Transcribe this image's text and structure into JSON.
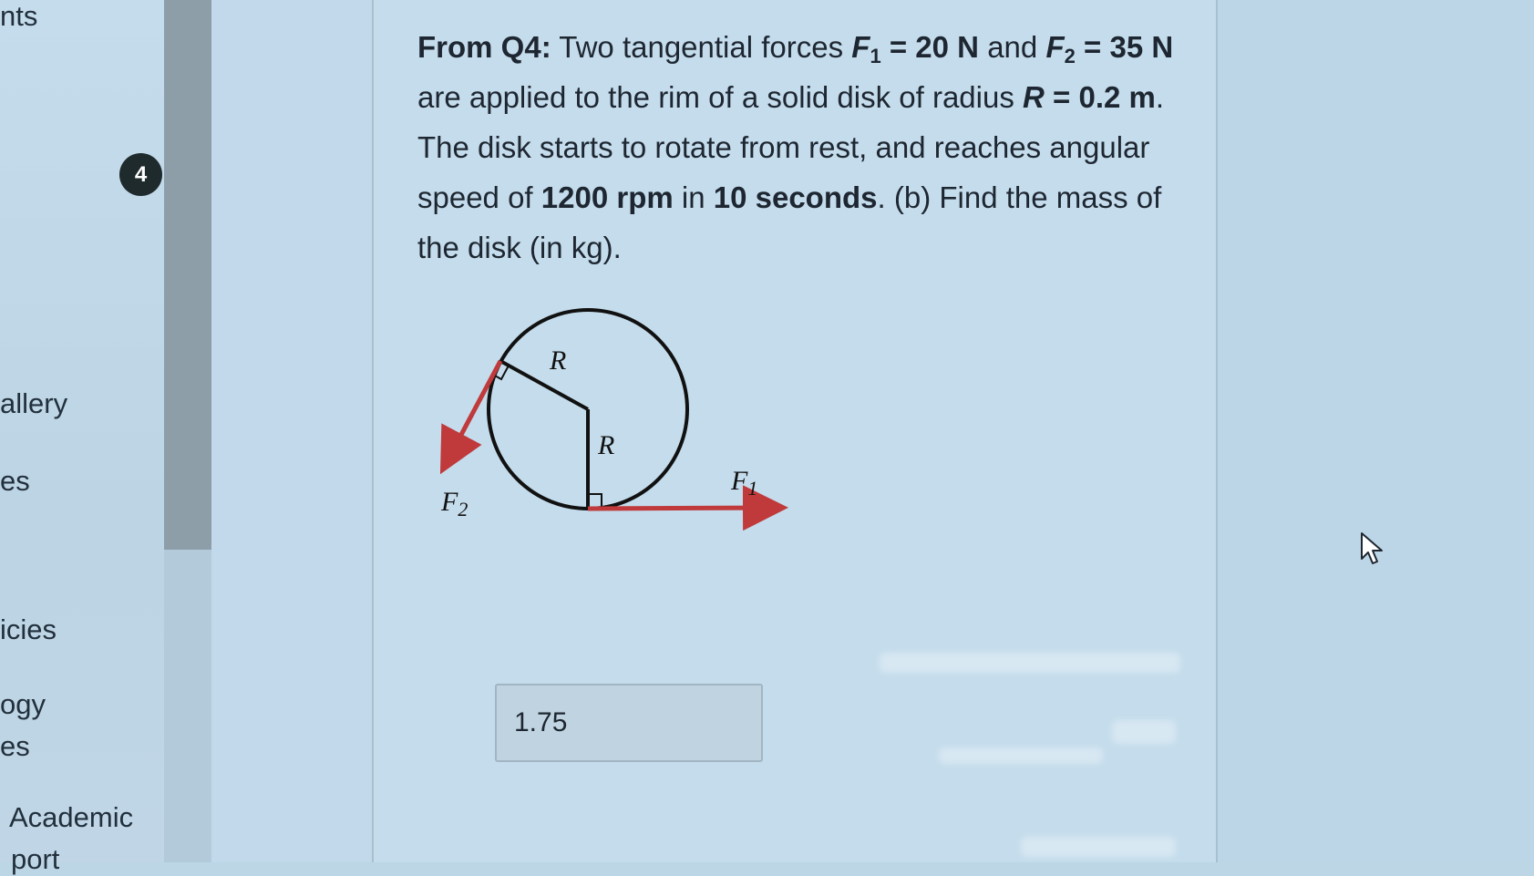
{
  "sidebar": {
    "items": [
      {
        "label": "nts"
      },
      {
        "label": "allery"
      },
      {
        "label": "es"
      },
      {
        "label": "icies"
      },
      {
        "label": "ogy"
      },
      {
        "label": "es"
      },
      {
        "label": "Academic"
      },
      {
        "label": "port"
      }
    ],
    "badge": "4"
  },
  "question": {
    "prefix": "From Q4:",
    "t1": " Two tangential forces ",
    "f1_sym": "F",
    "f1_sub": "1",
    "f1_val": " = 20 N",
    "t2": " and ",
    "f2_sym": "F",
    "f2_sub": "2",
    "f2_eq": " = 35 N",
    "t3": " are applied to the rim of a solid disk of radius ",
    "r_sym": "R",
    "r_val": " = 0.2 m",
    "t4": ". The disk starts to rotate from rest, and reaches angular speed of ",
    "speed": "1200 rpm",
    "t5": " in ",
    "time": "10 seconds",
    "t6": ". (b) Find the mass of the disk (in kg)."
  },
  "diagram": {
    "radius_label_1": "R",
    "radius_label_2": "R",
    "f1_label": "F",
    "f1_sub": "1",
    "f2_label": "F",
    "f2_sub": "2",
    "arrow_color": "#c0393b",
    "disk_color": "#111111"
  },
  "answer": {
    "value": "1.75"
  }
}
